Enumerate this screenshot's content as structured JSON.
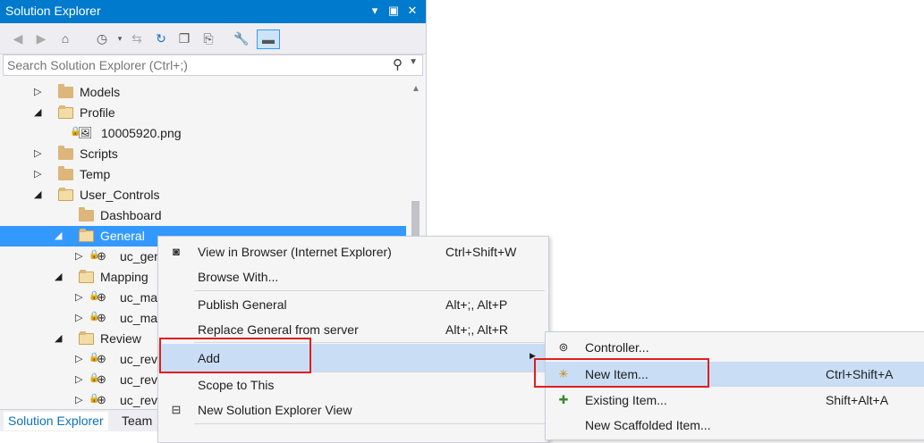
{
  "window": {
    "title": "Solution Explorer",
    "accent": "#007acc",
    "selection_color": "#3399ff",
    "highlight_color": "#c9def5",
    "callout_color": "#e01e1e"
  },
  "toolbar": {
    "icons": [
      "back-icon",
      "forward-icon",
      "home-icon",
      "history-icon",
      "sync-icon",
      "refresh-icon",
      "collapse-icon",
      "copy-icon",
      "wrench-icon",
      "pin-icon"
    ]
  },
  "search": {
    "placeholder": "Search Solution Explorer (Ctrl+;)"
  },
  "tree": [
    {
      "label": "Models"
    },
    {
      "label": "Profile"
    },
    {
      "label": "10005920.png"
    },
    {
      "label": "Scripts"
    },
    {
      "label": "Temp"
    },
    {
      "label": "User_Controls"
    },
    {
      "label": "Dashboard"
    },
    {
      "label": "General"
    },
    {
      "label": "uc_gen"
    },
    {
      "label": "Mapping"
    },
    {
      "label": "uc_ma"
    },
    {
      "label": "uc_ma"
    },
    {
      "label": "Review"
    },
    {
      "label": "uc_rev"
    },
    {
      "label": "uc_rev"
    },
    {
      "label": "uc_rev"
    }
  ],
  "bottom_tabs": [
    "Solution Explorer",
    "Team"
  ],
  "context_menu": [
    {
      "label": "View in Browser (Internet Explorer)",
      "shortcut": "Ctrl+Shift+W"
    },
    {
      "label": "Browse With...",
      "shortcut": ""
    },
    {
      "label": "Publish General",
      "shortcut": "Alt+;, Alt+P"
    },
    {
      "label": "Replace General from server",
      "shortcut": "Alt+;, Alt+R"
    },
    {
      "label": "Add",
      "shortcut": ""
    },
    {
      "label": "Scope to This",
      "shortcut": ""
    },
    {
      "label": "New Solution Explorer View",
      "shortcut": ""
    }
  ],
  "submenu": [
    {
      "label": "Controller...",
      "shortcut": ""
    },
    {
      "label": "New Item...",
      "shortcut": "Ctrl+Shift+A"
    },
    {
      "label": "Existing Item...",
      "shortcut": "Shift+Alt+A"
    },
    {
      "label": "New Scaffolded Item...",
      "shortcut": ""
    }
  ]
}
